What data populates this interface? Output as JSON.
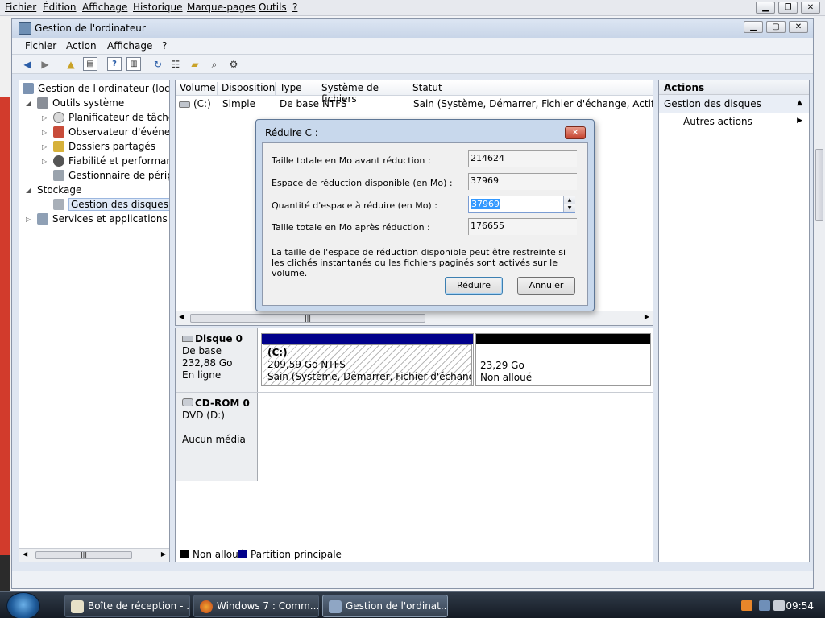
{
  "browser": {
    "menu": [
      "Fichier",
      "Édition",
      "Affichage",
      "Historique",
      "Marque-pages",
      "Outils",
      "?"
    ]
  },
  "mmc": {
    "title": "Gestion de l'ordinateur",
    "menu": [
      "Fichier",
      "Action",
      "Affichage",
      "?"
    ],
    "tree": {
      "root": "Gestion de l'ordinateur (local)",
      "items": [
        "Outils système",
        "Planificateur de tâches",
        "Observateur d'événeme",
        "Dossiers partagés",
        "Fiabilité et performance",
        "Gestionnaire de périphé",
        "Stockage",
        "Gestion des disques",
        "Services et applications"
      ]
    },
    "volumes": {
      "headers": [
        "Volume",
        "Disposition",
        "Type",
        "Système de fichiers",
        "Statut"
      ],
      "rows": [
        {
          "volume": "(C:)",
          "layout": "Simple",
          "type": "De base",
          "fs": "NTFS",
          "status": "Sain (Système, Démarrer, Fichier d'échange, Actif, Vidage"
        }
      ]
    },
    "disks": [
      {
        "name": "Disque 0",
        "type": "De base",
        "size": "232,88 Go",
        "state": "En ligne",
        "partitions": [
          {
            "label": "(C:)",
            "size": "209,59 Go NTFS",
            "status": "Sain (Système, Démarrer, Fichier d'échange, Act"
          },
          {
            "size": "23,29 Go",
            "status": "Non alloué"
          }
        ]
      },
      {
        "name": "CD-ROM 0",
        "type": "DVD (D:)",
        "state": "Aucun média"
      }
    ],
    "legend": [
      "Non alloué",
      "Partition principale"
    ],
    "actions": {
      "header": "Actions",
      "section": "Gestion des disques",
      "item": "Autres actions"
    }
  },
  "dialog": {
    "title": "Réduire C :",
    "fields": [
      {
        "label": "Taille totale en Mo avant réduction :",
        "value": "214624"
      },
      {
        "label": "Espace de réduction disponible (en Mo) :",
        "value": "37969"
      },
      {
        "label": "Quantité d'espace à réduire (en Mo) :",
        "value": "37969"
      },
      {
        "label": "Taille totale en Mo après réduction :",
        "value": "176655"
      }
    ],
    "note": "La taille de l'espace de réduction disponible peut être restreinte si les clichés instantanés ou les fichiers paginés sont activés sur le volume.",
    "ok_label": "Réduire",
    "cancel_label": "Annuler"
  },
  "taskbar": {
    "items": [
      "Boîte de réception - ...",
      "Windows 7 : Comm...",
      "Gestion de l'ordinat..."
    ],
    "clock": "09:54"
  },
  "colors": {
    "primary_partition": "#00008b",
    "unallocated": "#000000"
  }
}
